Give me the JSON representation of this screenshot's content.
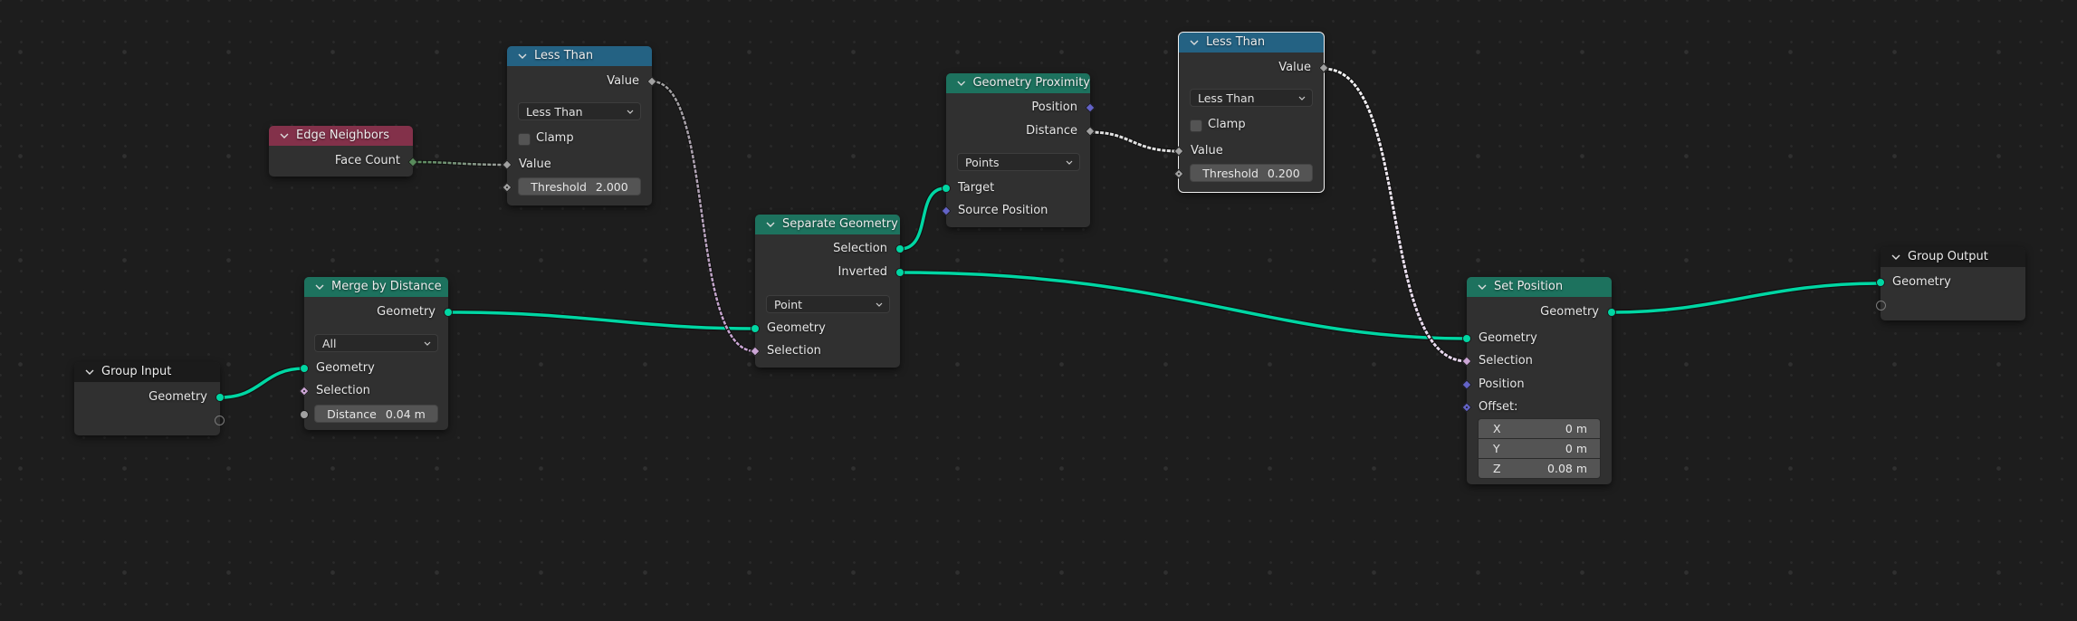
{
  "editor": "Geometry Node Editor",
  "colors": {
    "background": "#1d1d1d",
    "node_body": "#303030",
    "header_geometry": "#1d725e",
    "header_utility": "#246283",
    "header_input": "#83314a",
    "header_group": "#1b1b1b",
    "socket_geometry": "#00d6a3",
    "socket_float": "#a1a1a1",
    "socket_boolean": "#cca6d6",
    "socket_vector": "#6363c7",
    "socket_integer": "#598c5c",
    "link_geometry": "#00d6a3"
  },
  "nodes": {
    "group_input": {
      "title": "Group Input",
      "outputs": [
        "Geometry"
      ]
    },
    "edge_neighbors": {
      "title": "Edge Neighbors",
      "outputs": [
        "Face Count"
      ]
    },
    "less_than_1": {
      "title": "Less Than",
      "outputs": [
        "Value"
      ],
      "operation": "Less Than",
      "clamp_label": "Clamp",
      "clamp_checked": false,
      "inputs": [
        "Value"
      ],
      "threshold_label": "Threshold",
      "threshold_value": "2.000"
    },
    "merge_by_distance": {
      "title": "Merge by Distance",
      "outputs": [
        "Geometry"
      ],
      "mode": "All",
      "inputs": [
        "Geometry",
        "Selection"
      ],
      "distance_label": "Distance",
      "distance_value": "0.04 m"
    },
    "separate_geometry": {
      "title": "Separate Geometry",
      "outputs": [
        "Selection",
        "Inverted"
      ],
      "domain": "Point",
      "inputs": [
        "Geometry",
        "Selection"
      ]
    },
    "geometry_proximity": {
      "title": "Geometry Proximity",
      "outputs": [
        "Position",
        "Distance"
      ],
      "target_element": "Points",
      "inputs": [
        "Target",
        "Source Position"
      ]
    },
    "less_than_2": {
      "title": "Less Than",
      "selected": true,
      "outputs": [
        "Value"
      ],
      "operation": "Less Than",
      "clamp_label": "Clamp",
      "clamp_checked": false,
      "inputs": [
        "Value"
      ],
      "threshold_label": "Threshold",
      "threshold_value": "0.200"
    },
    "set_position": {
      "title": "Set Position",
      "outputs": [
        "Geometry"
      ],
      "inputs": [
        "Geometry",
        "Selection",
        "Position",
        "Offset:"
      ],
      "offset": [
        {
          "axis": "X",
          "value": "0 m"
        },
        {
          "axis": "Y",
          "value": "0 m"
        },
        {
          "axis": "Z",
          "value": "0.08 m"
        }
      ]
    },
    "group_output": {
      "title": "Group Output",
      "inputs": [
        "Geometry"
      ]
    }
  },
  "links": [
    {
      "from": "Group Input.Geometry",
      "to": "Merge by Distance.Geometry",
      "type": "geometry"
    },
    {
      "from": "Edge Neighbors.Face Count",
      "to": "Less Than.Value",
      "type": "field"
    },
    {
      "from": "Less Than.Value",
      "to": "Separate Geometry.Selection",
      "type": "field"
    },
    {
      "from": "Merge by Distance.Geometry",
      "to": "Separate Geometry.Geometry",
      "type": "geometry"
    },
    {
      "from": "Separate Geometry.Selection",
      "to": "Geometry Proximity.Target",
      "type": "geometry"
    },
    {
      "from": "Geometry Proximity.Distance",
      "to": "Less Than (2).Value",
      "type": "field"
    },
    {
      "from": "Separate Geometry.Inverted",
      "to": "Set Position.Geometry",
      "type": "geometry"
    },
    {
      "from": "Less Than (2).Value",
      "to": "Set Position.Selection",
      "type": "field"
    },
    {
      "from": "Set Position.Geometry",
      "to": "Group Output.Geometry",
      "type": "geometry"
    }
  ]
}
